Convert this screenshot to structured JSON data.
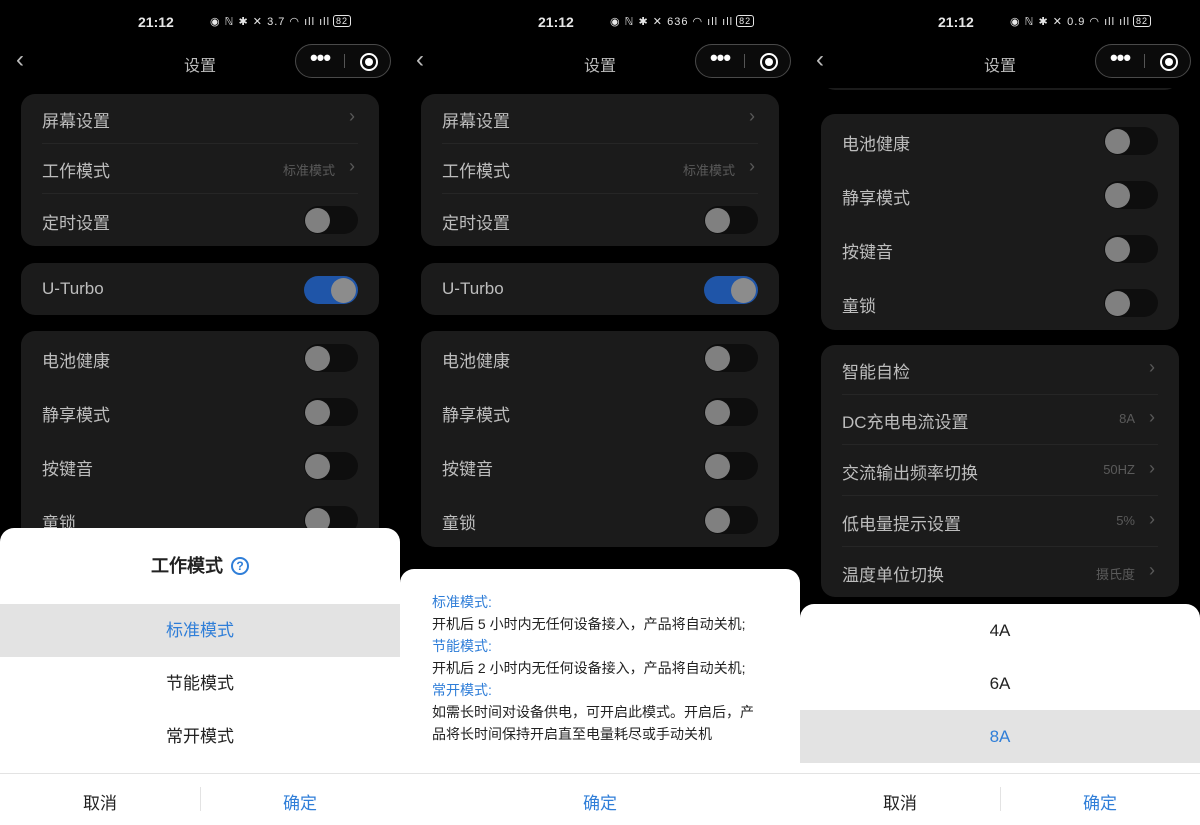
{
  "status": {
    "time": "21:12",
    "batt": "82",
    "speeds": [
      "3.7",
      "636",
      "0.9"
    ]
  },
  "nav": {
    "title": "设置"
  },
  "settings": {
    "screen": "屏幕设置",
    "work_mode": "工作模式",
    "work_mode_value": "标准模式",
    "timer": "定时设置",
    "uturbo": "U-Turbo",
    "battery_health": "电池健康",
    "quiet_mode": "静享模式",
    "key_sound": "按键音",
    "child_lock": "童锁",
    "self_check": "智能自检",
    "dc_current": "DC充电电流设置",
    "dc_current_value": "8A",
    "ac_freq": "交流输出频率切换",
    "ac_freq_value": "50HZ",
    "low_batt": "低电量提示设置",
    "low_batt_value": "5%",
    "temp_unit": "温度单位切换",
    "temp_unit_value": "摄氏度"
  },
  "toggles": {
    "timer": false,
    "uturbo": true,
    "battery_health": false,
    "quiet_mode": false,
    "key_sound": false,
    "child_lock": false
  },
  "mode_sheet": {
    "title": "工作模式",
    "options": [
      "标准模式",
      "节能模式",
      "常开模式"
    ],
    "selected": "标准模式"
  },
  "info_sheet": {
    "lines": [
      {
        "text": "标准模式:",
        "head": true
      },
      {
        "text": "开机后 5 小时内无任何设备接入，产品将自动关机;",
        "head": false
      },
      {
        "text": "节能模式:",
        "head": true
      },
      {
        "text": "开机后 2 小时内无任何设备接入，产品将自动关机;",
        "head": false
      },
      {
        "text": "常开模式:",
        "head": true
      },
      {
        "text": "如需长时间对设备供电，可开启此模式。开启后，产",
        "head": false
      },
      {
        "text": "品将长时间保持开启直至电量耗尽或手动关机",
        "head": false
      }
    ]
  },
  "current_sheet": {
    "options": [
      "4A",
      "6A",
      "8A"
    ],
    "selected": "8A"
  },
  "buttons": {
    "cancel": "取消",
    "confirm": "确定"
  },
  "colors": {
    "accent": "#2f7ed8",
    "toggle_on": "#1f55a8",
    "card": "#1b1b1b"
  }
}
